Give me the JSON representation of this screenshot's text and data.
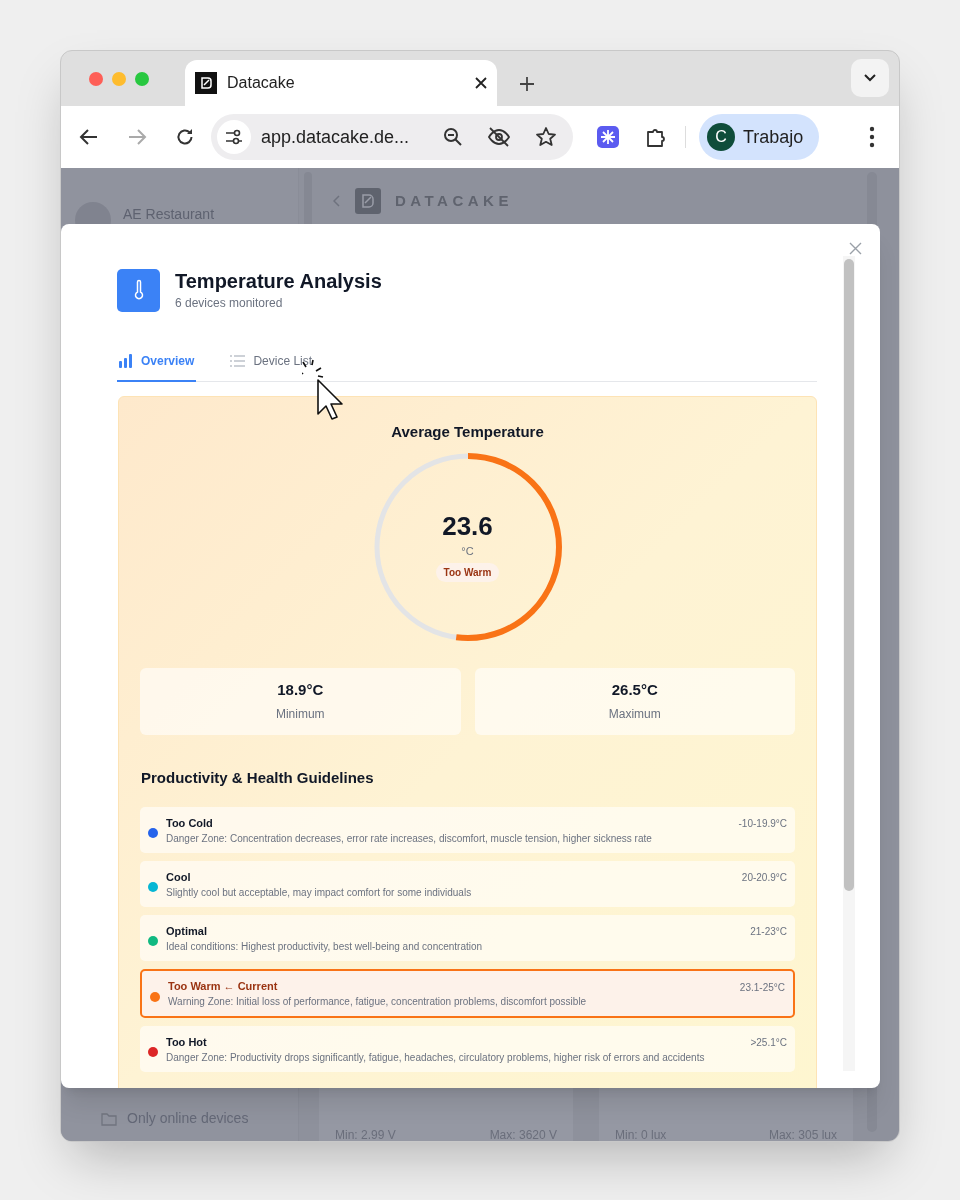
{
  "browser": {
    "tab": {
      "title": "Datacake",
      "selected": true
    },
    "address": "app.datacake.de...",
    "profile": {
      "initial": "C",
      "name": "Trabajo"
    }
  },
  "background_app": {
    "workspace_name": "AE Restaurant",
    "logo_text": "DATACAKE",
    "sidebar_items": [
      "Only online devices"
    ],
    "cards": [
      {
        "min": "Min: 2.99 V",
        "max": "Max: 3620 V"
      },
      {
        "min": "Min: 0 lux",
        "max": "Max: 305 lux"
      }
    ]
  },
  "modal": {
    "title": "Temperature Analysis",
    "subtitle": "6 devices monitored",
    "tabs": [
      {
        "label": "Overview",
        "selected": true,
        "kind": "bars"
      },
      {
        "label": "Device List",
        "selected": false,
        "kind": "list"
      }
    ],
    "gauge": {
      "title": "Average Temperature",
      "value": "23.6",
      "unit": "°C",
      "status": "Too Warm",
      "level": 0.52
    },
    "stats": [
      {
        "value": "18.9°C",
        "label": "Minimum"
      },
      {
        "value": "26.5°C",
        "label": "Maximum"
      }
    ],
    "guidelines": {
      "title": "Productivity & Health Guidelines",
      "current_label": "← Current",
      "items": [
        {
          "name": "Too Cold",
          "description": "Danger Zone: Concentration decreases, error rate increases, discomfort, muscle tension, higher sickness rate",
          "range": "-10-19.9°C",
          "color": "#2563eb",
          "current": false
        },
        {
          "name": "Cool",
          "description": "Slightly cool but acceptable, may impact comfort for some individuals",
          "range": "20-20.9°C",
          "color": "#06b6d4",
          "current": false
        },
        {
          "name": "Optimal",
          "description": "Ideal conditions: Highest productivity, best well-being and concentration",
          "range": "21-23°C",
          "color": "#10b981",
          "current": false
        },
        {
          "name": "Too Warm",
          "description": "Warning Zone: Initial loss of performance, fatigue, concentration problems, discomfort possible",
          "range": "23.1-25°C",
          "color": "#f97316",
          "current": true
        },
        {
          "name": "Too Hot",
          "description": "Danger Zone: Productivity drops significantly, fatigue, headaches, circulatory problems, higher risk of errors and accidents",
          "range": ">25.1°C",
          "color": "#dc2626",
          "current": false
        }
      ]
    }
  }
}
